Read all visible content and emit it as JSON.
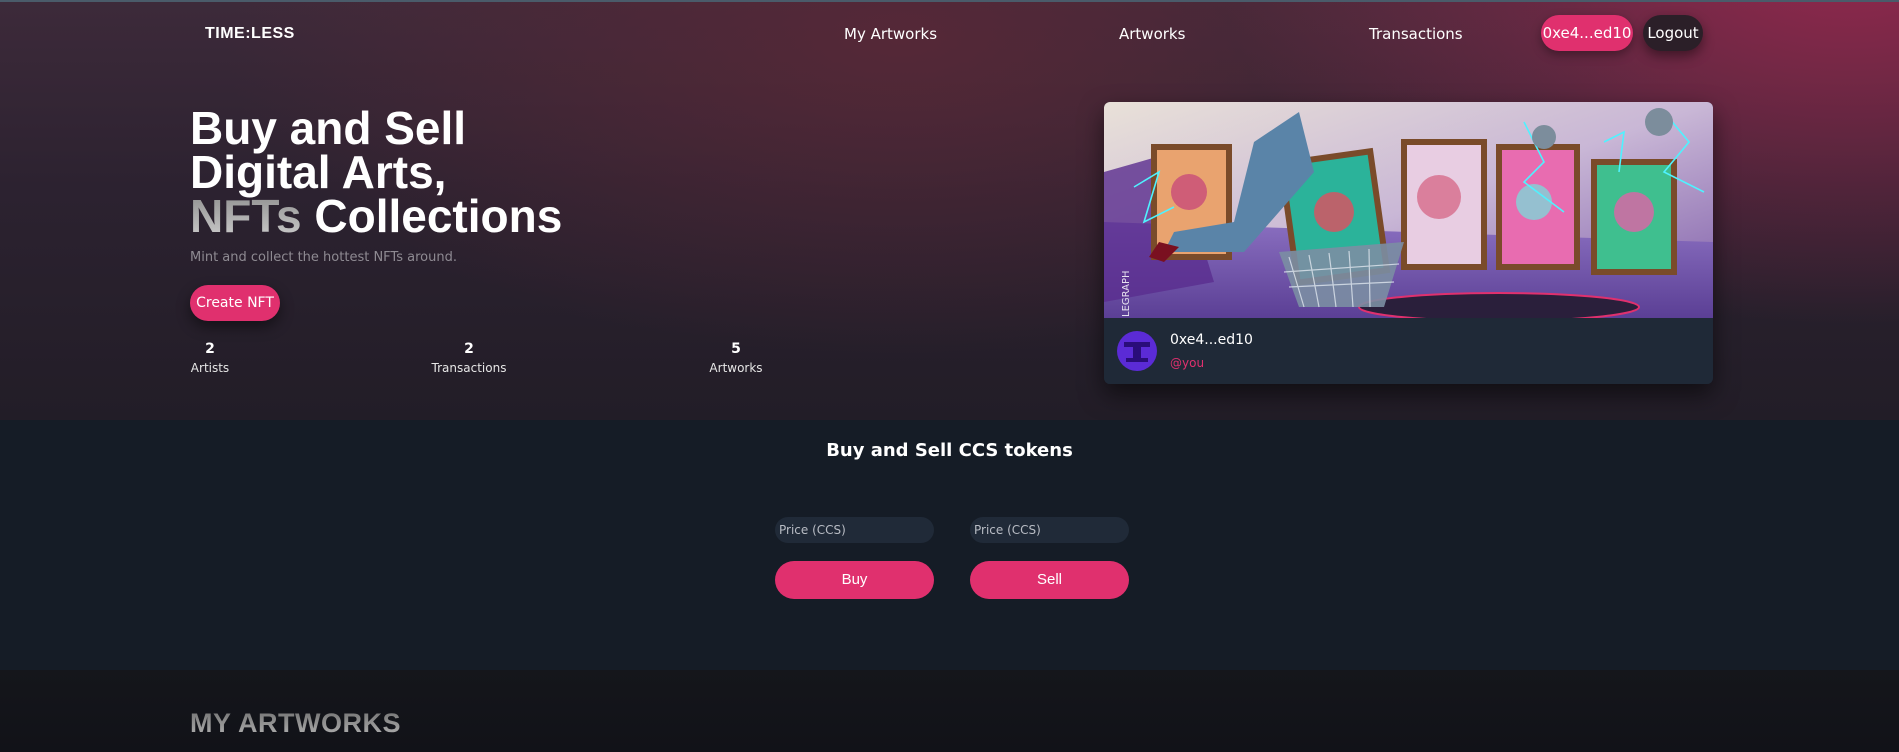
{
  "nav": {
    "logo": "TIME:LESS",
    "links": [
      "My Artworks",
      "Artworks",
      "Transactions"
    ],
    "wallet": "0xe4...ed10",
    "logout": "Logout"
  },
  "hero": {
    "title_line1": "Buy and Sell",
    "title_line2": "Digital Arts,",
    "title_word_gradient": "NFTs",
    "title_word_rest": " Collections",
    "subtitle": "Mint and collect the hottest NFTs around.",
    "create_button": "Create NFT",
    "stats": [
      {
        "value": "2",
        "label": "Artists"
      },
      {
        "value": "2",
        "label": "Transactions"
      },
      {
        "value": "5",
        "label": "Artworks"
      }
    ]
  },
  "card": {
    "owner_address": "0xe4...ed10",
    "owner_handle": "@you",
    "watermark": "LEGRAPH"
  },
  "tokens": {
    "title": "Buy and Sell CCS tokens",
    "buy_placeholder": "Price (CCS)",
    "sell_placeholder": "Price (CCS)",
    "buy_button": "Buy",
    "sell_button": "Sell"
  },
  "my_artworks": {
    "title": "MY ARTWORKS"
  },
  "colors": {
    "accent": "#e0306e",
    "section_bg": "#151c26",
    "card_footer": "#1f2937"
  }
}
